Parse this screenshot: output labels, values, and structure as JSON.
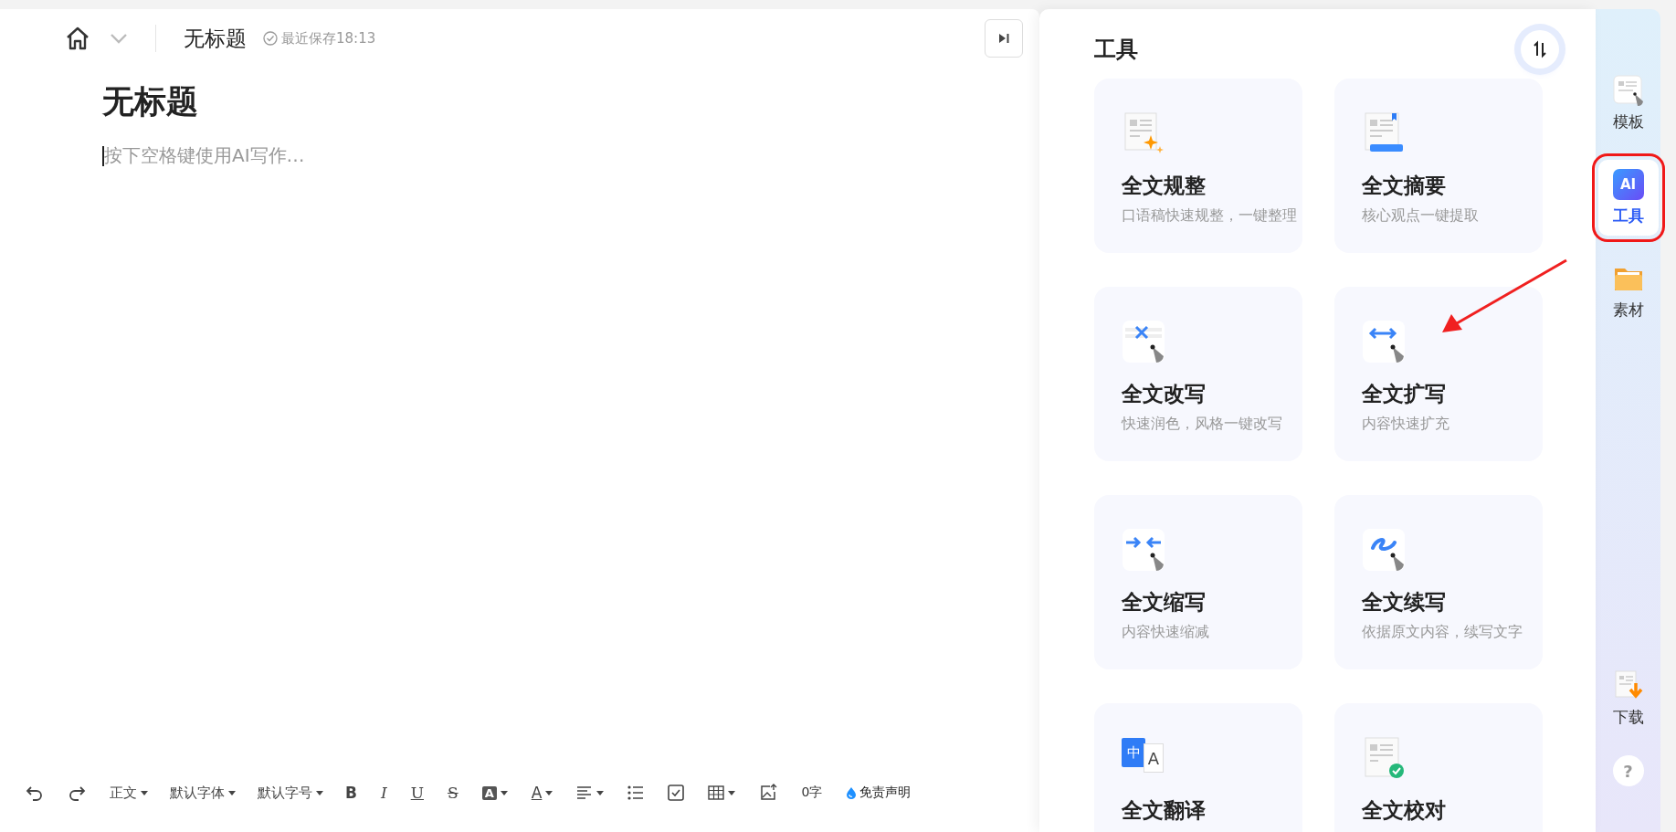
{
  "header": {
    "doc_name": "无标题",
    "save_status": "最近保存18:13"
  },
  "document": {
    "title": "无标题",
    "placeholder": "按下空格键使用AI写作…"
  },
  "toolbar": [
    {
      "kind": "undo"
    },
    {
      "kind": "redo"
    },
    {
      "kind": "text",
      "label": "正文",
      "dropdown": true
    },
    {
      "kind": "text",
      "label": "默认字体",
      "dropdown": true
    },
    {
      "kind": "text",
      "label": "默认字号",
      "dropdown": true
    },
    {
      "kind": "bold",
      "label": "B"
    },
    {
      "kind": "italic",
      "label": "I"
    },
    {
      "kind": "underline",
      "label": "U"
    },
    {
      "kind": "strike",
      "label": "S"
    },
    {
      "kind": "highlight",
      "label": "A",
      "dropdown": true
    },
    {
      "kind": "fontcolor",
      "label": "A",
      "dropdown": true
    },
    {
      "kind": "align",
      "dropdown": true
    },
    {
      "kind": "list"
    },
    {
      "kind": "todo"
    },
    {
      "kind": "table",
      "dropdown": true
    },
    {
      "kind": "image"
    },
    {
      "kind": "count",
      "label": "0字"
    },
    {
      "kind": "disclaimer",
      "label": "免责声明"
    }
  ],
  "tools_panel": {
    "title": "工具",
    "cards": [
      {
        "kind": "doc-sparkle",
        "title": "全文规整",
        "description": "口语稿快速规整，一键整理"
      },
      {
        "kind": "doc-bookmark",
        "title": "全文摘要",
        "description": "核心观点一键提取"
      },
      {
        "kind": "rewrite",
        "title": "全文改写",
        "description": "快速润色，风格一键改写"
      },
      {
        "kind": "expand",
        "title": "全文扩写",
        "description": "内容快速扩充"
      },
      {
        "kind": "shrink",
        "title": "全文缩写",
        "description": "内容快速缩减"
      },
      {
        "kind": "continue",
        "title": "全文续写",
        "description": "依据原文内容，续写文字"
      },
      {
        "kind": "translate",
        "title": "全文翻译",
        "glyphs": [
          "中",
          "A"
        ]
      },
      {
        "kind": "proofread",
        "title": "全文校对"
      }
    ]
  },
  "sidebar": {
    "items": [
      {
        "kind": "template",
        "label": "模板",
        "selected": false,
        "highlighted": false
      },
      {
        "kind": "ai",
        "label": "工具",
        "glyph": "AI",
        "selected": true,
        "highlighted": true
      },
      {
        "kind": "folder",
        "label": "素材",
        "selected": false,
        "highlighted": false
      }
    ],
    "bottom_items": [
      {
        "kind": "download",
        "label": "下载"
      },
      {
        "kind": "help",
        "label": "?"
      }
    ]
  }
}
